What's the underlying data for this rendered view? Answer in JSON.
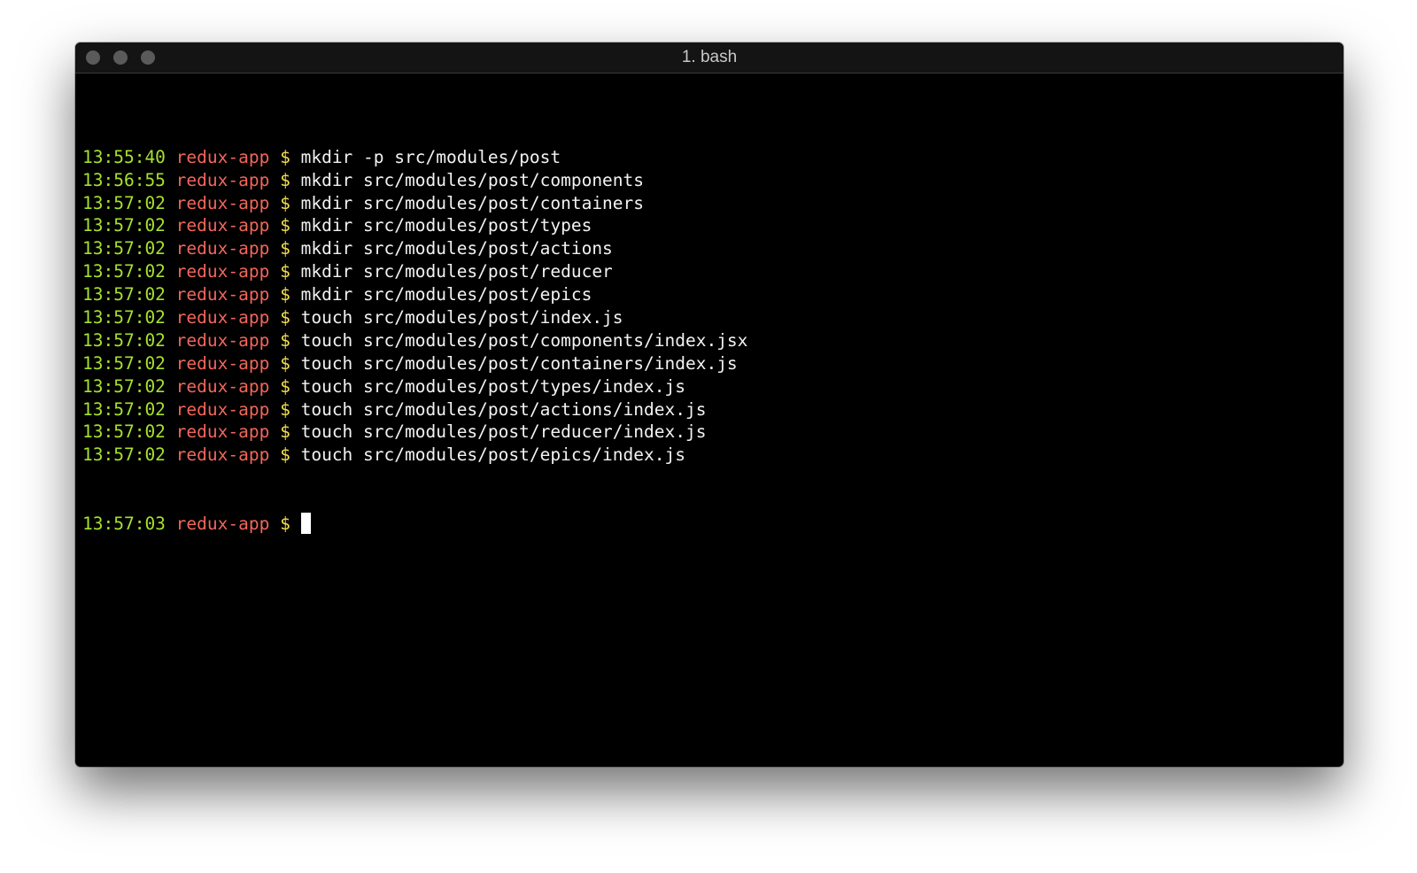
{
  "window": {
    "title": "1. bash"
  },
  "colors": {
    "timestamp": "#a6e22e",
    "host": "#f2665a",
    "prompt_symbol": "#f4e04d",
    "command": "#f2f2f2",
    "background": "#000000"
  },
  "lines": [
    {
      "time": "13:55:40",
      "host": "redux-app",
      "prompt": "$",
      "cmd": "mkdir -p src/modules/post"
    },
    {
      "time": "13:56:55",
      "host": "redux-app",
      "prompt": "$",
      "cmd": "mkdir src/modules/post/components"
    },
    {
      "time": "13:57:02",
      "host": "redux-app",
      "prompt": "$",
      "cmd": "mkdir src/modules/post/containers"
    },
    {
      "time": "13:57:02",
      "host": "redux-app",
      "prompt": "$",
      "cmd": "mkdir src/modules/post/types"
    },
    {
      "time": "13:57:02",
      "host": "redux-app",
      "prompt": "$",
      "cmd": "mkdir src/modules/post/actions"
    },
    {
      "time": "13:57:02",
      "host": "redux-app",
      "prompt": "$",
      "cmd": "mkdir src/modules/post/reducer"
    },
    {
      "time": "13:57:02",
      "host": "redux-app",
      "prompt": "$",
      "cmd": "mkdir src/modules/post/epics"
    },
    {
      "time": "13:57:02",
      "host": "redux-app",
      "prompt": "$",
      "cmd": "touch src/modules/post/index.js"
    },
    {
      "time": "13:57:02",
      "host": "redux-app",
      "prompt": "$",
      "cmd": "touch src/modules/post/components/index.jsx"
    },
    {
      "time": "13:57:02",
      "host": "redux-app",
      "prompt": "$",
      "cmd": "touch src/modules/post/containers/index.js"
    },
    {
      "time": "13:57:02",
      "host": "redux-app",
      "prompt": "$",
      "cmd": "touch src/modules/post/types/index.js"
    },
    {
      "time": "13:57:02",
      "host": "redux-app",
      "prompt": "$",
      "cmd": "touch src/modules/post/actions/index.js"
    },
    {
      "time": "13:57:02",
      "host": "redux-app",
      "prompt": "$",
      "cmd": "touch src/modules/post/reducer/index.js"
    },
    {
      "time": "13:57:02",
      "host": "redux-app",
      "prompt": "$",
      "cmd": "touch src/modules/post/epics/index.js"
    }
  ],
  "current": {
    "time": "13:57:03",
    "host": "redux-app",
    "prompt": "$",
    "input": ""
  }
}
